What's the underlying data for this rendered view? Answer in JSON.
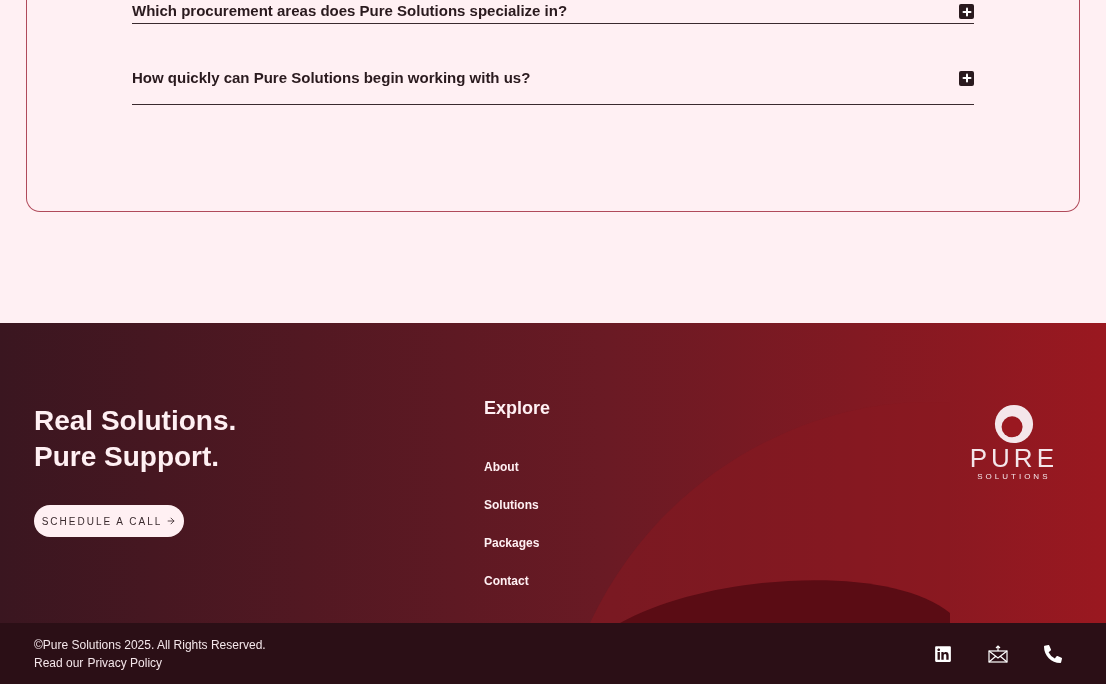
{
  "faq": {
    "items": [
      {
        "question": "Which procurement areas does Pure Solutions specialize in?",
        "expanded": false
      },
      {
        "question": "How quickly can Pure Solutions begin working with us?",
        "expanded": false
      }
    ]
  },
  "footer": {
    "tagline": [
      "Real Solutions.",
      "Pure Support."
    ],
    "cta": "SCHEDULE A CALL",
    "explore": {
      "title": "Explore",
      "links": [
        "About",
        "Solutions",
        "Packages",
        "Contact"
      ]
    },
    "logo": {
      "name": "PURE",
      "subtitle": "SOLUTIONS"
    },
    "copyright": "©Pure Solutions 2025. All Rights Reserved.",
    "privacy": {
      "prefix": "Read our",
      "link": "Privacy Policy"
    }
  }
}
